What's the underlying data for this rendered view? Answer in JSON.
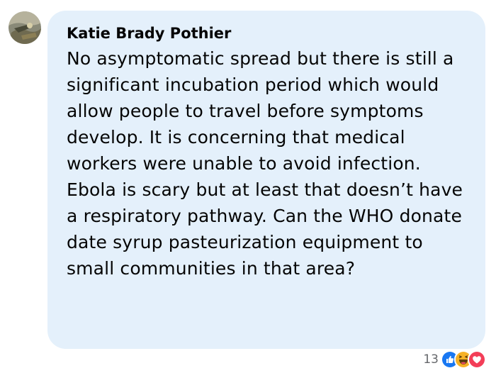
{
  "comment": {
    "author": "Katie Brady Pothier",
    "text": "No asymptomatic spread but there is still a significant incubation period which would allow people to travel before symptoms develop. It is concerning that medical workers were unable to avoid infection. Ebola is scary but at least that doesn’t have a respiratory pathway. Can the WHO donate date syrup pasteurization equipment to small communities in that area?",
    "reactions": {
      "count": "13",
      "icons": [
        "like-icon",
        "haha-icon",
        "love-icon"
      ]
    }
  },
  "colors": {
    "bubble": "#e4f0fb",
    "text": "#050505",
    "muted": "#65676b",
    "like": "#1877f2",
    "haha": "#f7b125",
    "love": "#f33e58"
  }
}
